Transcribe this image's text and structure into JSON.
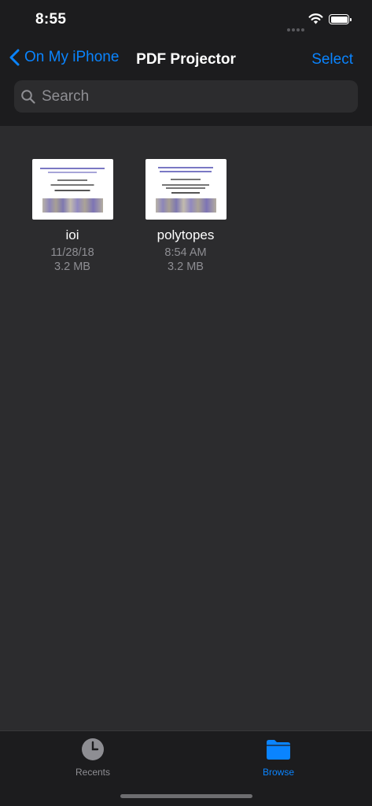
{
  "status": {
    "time": "8:55"
  },
  "nav": {
    "back_label": "On My iPhone",
    "title": "PDF Projector",
    "select_label": "Select"
  },
  "search": {
    "placeholder": "Search"
  },
  "files": [
    {
      "name": "ioi",
      "date": "11/28/18",
      "size": "3.2 MB"
    },
    {
      "name": "polytopes",
      "date": "8:54 AM",
      "size": "3.2 MB"
    }
  ],
  "tabs": [
    {
      "label": "Recents",
      "icon": "clock-icon",
      "active": false
    },
    {
      "label": "Browse",
      "icon": "folder-icon",
      "active": true
    }
  ],
  "colors": {
    "accent": "#0a84ff",
    "background": "#2c2c2e",
    "bar": "#1c1c1e",
    "secondary_text": "#8e8e93"
  }
}
